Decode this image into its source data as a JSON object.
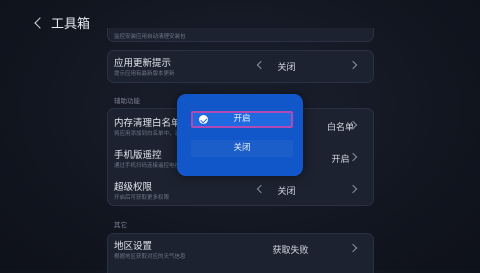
{
  "header": {
    "title": "工具箱"
  },
  "top_card": {
    "desc": "监控安装应用自动清理安装包"
  },
  "app_update": {
    "name": "应用更新提示",
    "desc": "提示应用有最新版本更新",
    "value": "关闭"
  },
  "section_assist": "辅助功能",
  "memory_whitelist": {
    "name": "内存清理白名单",
    "desc": "将应用添加到白名单中，清理内存时不会被清理",
    "value": "白名单"
  },
  "phone_remote": {
    "name": "手机版遥控",
    "desc": "通过手机扫码连接遥控电视",
    "value": "开启"
  },
  "super_perm": {
    "name": "超级权限",
    "desc": "开启后可获取更多权限",
    "value": "关闭"
  },
  "section_other": "其它",
  "region": {
    "name": "地区设置",
    "desc": "根据地区获取对应的天气信息",
    "value": "获取失败"
  },
  "dialog": {
    "option_on": "开启",
    "option_off": "关闭"
  }
}
